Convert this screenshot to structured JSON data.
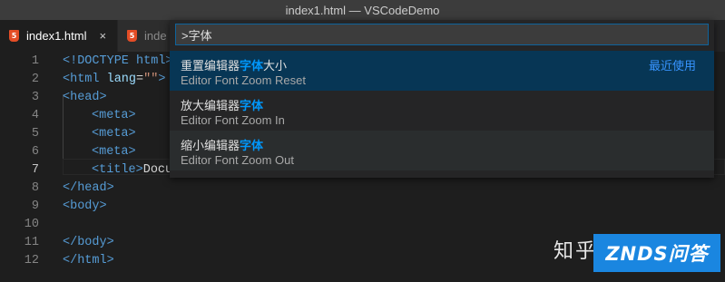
{
  "window": {
    "title": "index1.html — VSCodeDemo"
  },
  "tabs": [
    {
      "label": "index1.html",
      "close": "×"
    },
    {
      "label": "inde"
    }
  ],
  "editor": {
    "line_numbers": [
      "1",
      "2",
      "3",
      "4",
      "5",
      "6",
      "7",
      "8",
      "9",
      "10",
      "11",
      "12"
    ],
    "current_line": "7"
  },
  "code": {
    "l1": {
      "tag": "<!DOCTYPE html>"
    },
    "l2": {
      "open": "<html ",
      "attr": "lang",
      "eq": "=",
      "val": "\"\"",
      "close": ">"
    },
    "l3": "<head>",
    "l4": "<meta>",
    "l5": "<meta>",
    "l6": "<meta>",
    "l7": {
      "tag": "<title>",
      "text": "Docu"
    },
    "l8": "</head>",
    "l9": "<body>",
    "l11": "</body>",
    "l12": "</html>"
  },
  "palette": {
    "query": ">字体",
    "items": [
      {
        "label_pre": "重置编辑器",
        "label_hl": "字体",
        "label_post": "大小",
        "desc": "Editor Font Zoom Reset",
        "badge": "最近使用"
      },
      {
        "label_pre": "放大编辑器",
        "label_hl": "字体",
        "label_post": "",
        "desc": "Editor Font Zoom In"
      },
      {
        "label_pre": "缩小编辑器",
        "label_hl": "字体",
        "label_post": "",
        "desc": "Editor Font Zoom Out"
      }
    ]
  },
  "watermark": {
    "zhihu": "知乎",
    "badge": "ZNDS问答"
  }
}
